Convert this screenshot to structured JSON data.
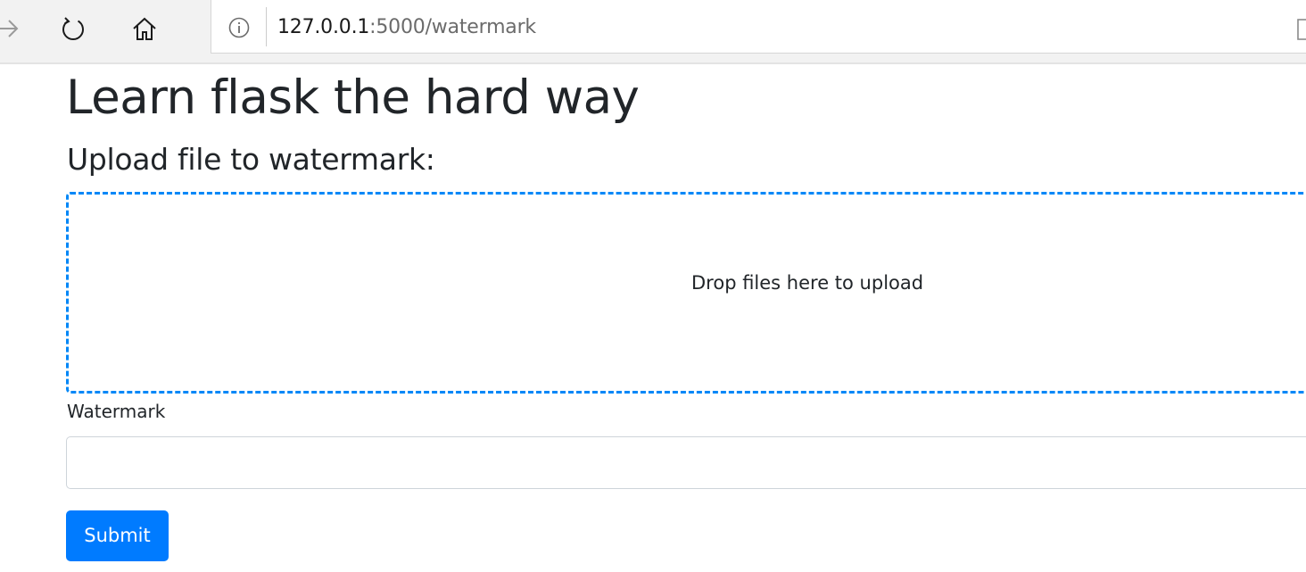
{
  "browser": {
    "url_host": "127.0.0.1",
    "url_rest": ":5000/watermark",
    "icons": {
      "forward": "arrow-right-icon",
      "refresh": "refresh-icon",
      "home": "home-icon",
      "info": "info-icon",
      "reading": "reading-view-icon"
    }
  },
  "page": {
    "title": "Learn flask the hard way",
    "upload_heading": "Upload file to watermark:",
    "dropzone_message": "Drop files here to upload",
    "watermark_label": "Watermark",
    "watermark_value": "",
    "submit_label": "Submit"
  },
  "colors": {
    "accent": "#007bff",
    "dropzone_border": "#0087f7",
    "text": "#212529"
  }
}
